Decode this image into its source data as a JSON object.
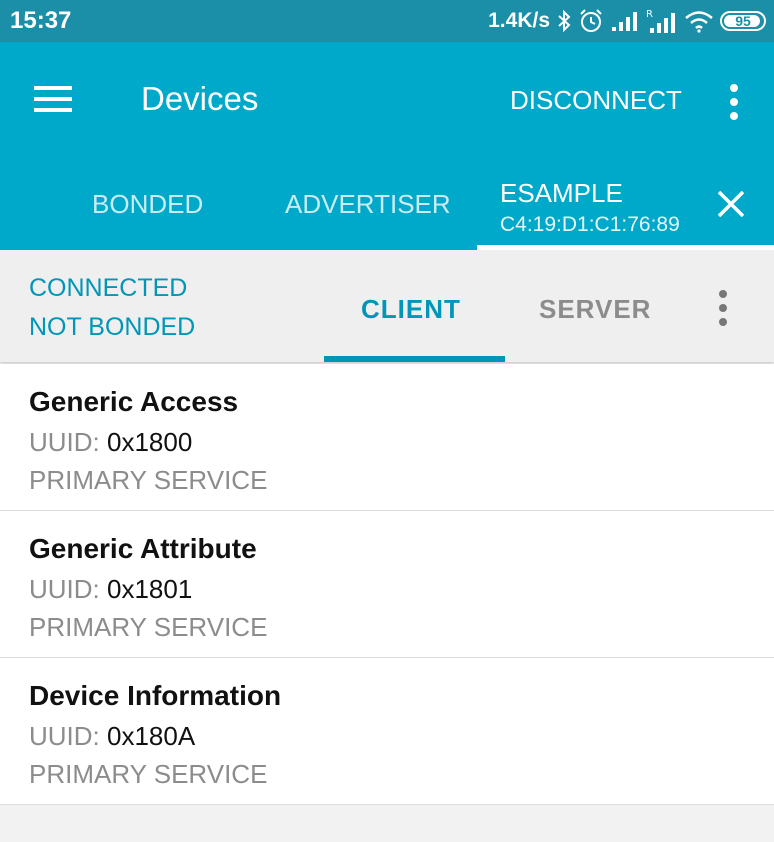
{
  "status_bar": {
    "time": "15:37",
    "net_speed": "1.4K/s",
    "battery": "95",
    "battery_level": 0.95,
    "icons": [
      "bluetooth-icon",
      "alarm-icon",
      "signal-icon",
      "signal-roaming-icon",
      "wifi-icon",
      "battery-icon"
    ]
  },
  "app_bar": {
    "title": "Devices",
    "disconnect_label": "DISCONNECT",
    "menu_icon": "hamburger-menu-icon",
    "overflow_icon": "more-vert-icon"
  },
  "tabs": [
    {
      "label": "BONDED"
    },
    {
      "label": "ADVERTISER"
    },
    {
      "label": "ESAMPLE",
      "address": "C4:19:D1:C1:76:89",
      "selected": true
    }
  ],
  "connection": {
    "state": "CONNECTED",
    "bond_state": "NOT BONDED"
  },
  "sub_tabs": [
    {
      "label": "CLIENT",
      "selected": true
    },
    {
      "label": "SERVER"
    }
  ],
  "services": [
    {
      "name": "Generic Access",
      "uuid_label": "UUID:",
      "uuid": "0x1800",
      "type": "PRIMARY SERVICE"
    },
    {
      "name": "Generic Attribute",
      "uuid_label": "UUID:",
      "uuid": "0x1801",
      "type": "PRIMARY SERVICE"
    },
    {
      "name": "Device Information",
      "uuid_label": "UUID:",
      "uuid": "0x180A",
      "type": "PRIMARY SERVICE"
    }
  ],
  "colors": {
    "status_bar": "#1b8fa8",
    "app_bar": "#00a9c9",
    "accent": "#0096b7",
    "secondary_text": "#8c8c8c"
  }
}
